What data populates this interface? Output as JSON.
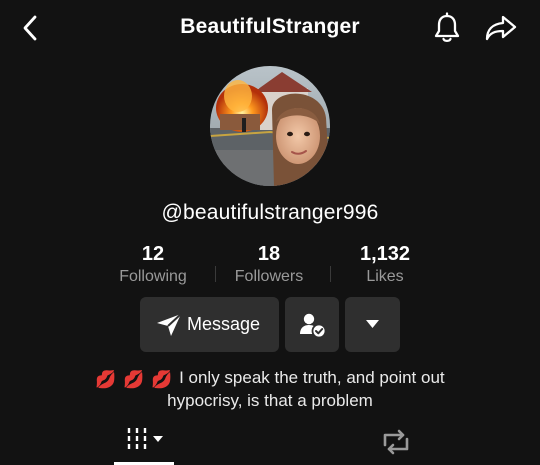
{
  "header": {
    "title": "BeautifulStranger"
  },
  "icons": {
    "back": "chevron-left-icon",
    "notifications": "bell-icon",
    "share": "share-arrow-icon",
    "message": "send-icon",
    "follow_status": "user-check-icon",
    "more": "caret-down-icon",
    "videos_tab": "grid-bars-icon",
    "reposts_tab": "repost-icon"
  },
  "profile": {
    "handle": "@beautifulstranger996",
    "stats": [
      {
        "value": "12",
        "label": "Following"
      },
      {
        "value": "18",
        "label": "Followers"
      },
      {
        "value": "1,132",
        "label": "Likes"
      }
    ],
    "message_label": "Message",
    "bio_emojis": [
      "💋",
      "💋",
      "💋"
    ],
    "bio_line1": "I only speak the truth, and point out",
    "bio_line2": "hypocrisy, is that a problem"
  },
  "tabs": {
    "active": "videos"
  },
  "colors": {
    "background": "#121212",
    "button": "#2f2f2f",
    "secondary_text": "#9a9a9a"
  }
}
